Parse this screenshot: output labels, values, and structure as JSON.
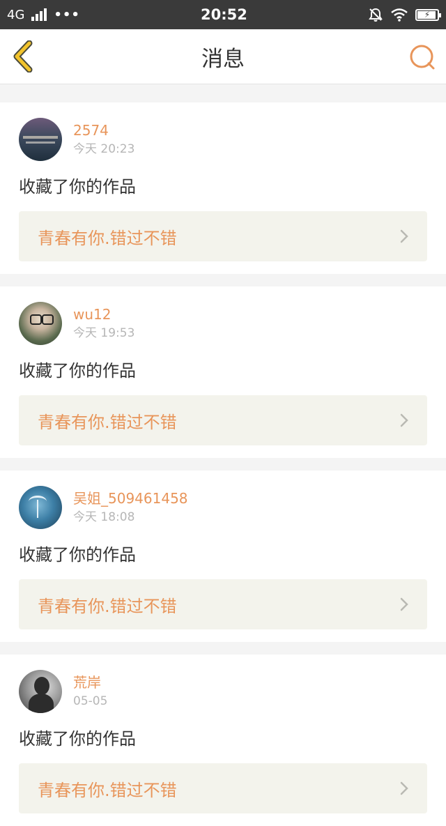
{
  "status_bar": {
    "network": "4G",
    "dots": "•••",
    "time": "20:52"
  },
  "header": {
    "title": "消息"
  },
  "messages": [
    {
      "username": "2574",
      "time": "今天 20:23",
      "action": "收藏了你的作品",
      "work_title": "青春有你.错过不错"
    },
    {
      "username": "wu12",
      "time": "今天 19:53",
      "action": "收藏了你的作品",
      "work_title": "青春有你.错过不错"
    },
    {
      "username": "吴姐_509461458",
      "time": "今天 18:08",
      "action": "收藏了你的作品",
      "work_title": "青春有你.错过不错"
    },
    {
      "username": "荒岸",
      "time": "05-05",
      "action": "收藏了你的作品",
      "work_title": "青春有你.错过不错"
    }
  ],
  "colors": {
    "accent": "#e8955a",
    "back_icon": "#f2c32c",
    "status_bar": "#3a3a3a"
  },
  "icons": [
    "back-arrow-icon",
    "search-icon",
    "chevron-right-icon",
    "signal-icon",
    "wifi-icon",
    "mute-icon",
    "battery-icon"
  ]
}
